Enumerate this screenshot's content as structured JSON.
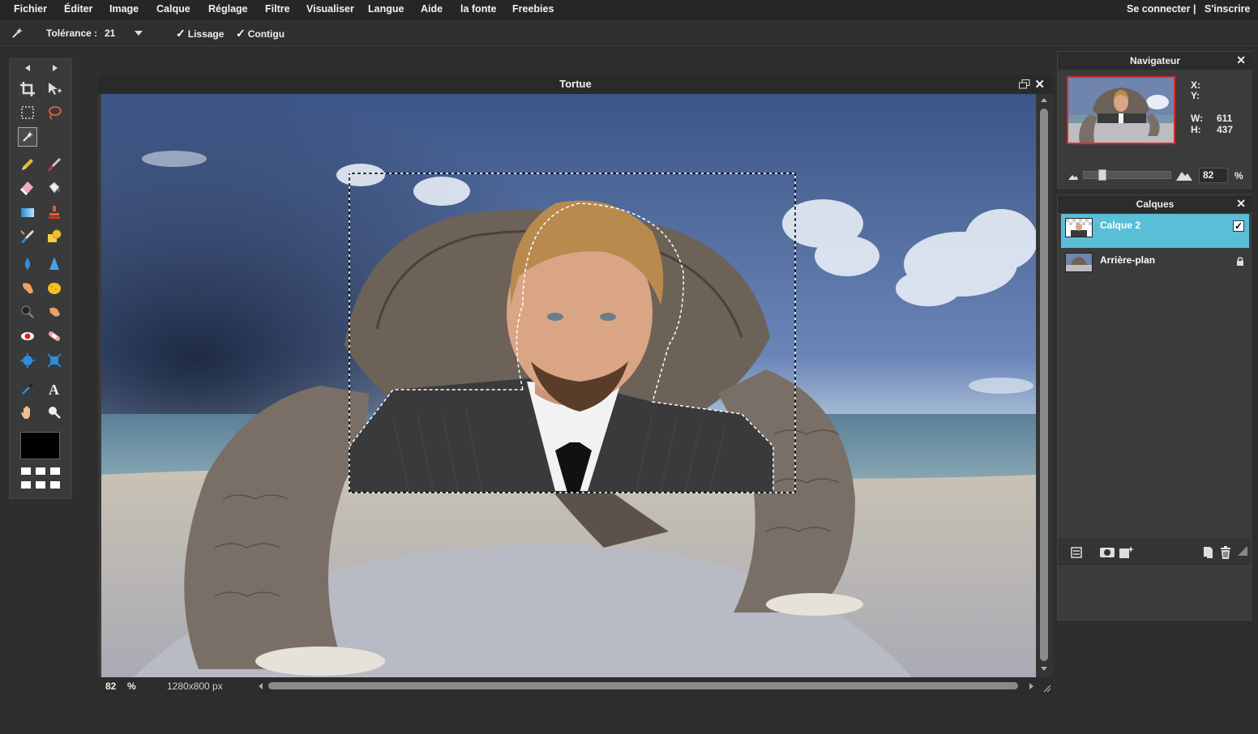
{
  "menubar": {
    "items": [
      "Fichier",
      "Éditer",
      "Image",
      "Calque",
      "Réglage",
      "Filtre",
      "Visualiser",
      "Langue",
      "Aide",
      "la fonte",
      "Freebies"
    ],
    "login": "Se connecter",
    "separator": "|",
    "signup": "S'inscrire"
  },
  "options": {
    "tool_icon": "magic-wand-icon",
    "tolerance_label": "Tolérance :",
    "tolerance_value": "21",
    "antialias_label": "Lissage",
    "antialias_checked": true,
    "contiguous_label": "Contigu",
    "contiguous_checked": true
  },
  "tools": {
    "items": [
      "crop",
      "move",
      "marquee",
      "lasso",
      "magic-wand",
      "pencil",
      "brush",
      "eraser",
      "paint-bucket",
      "gradient",
      "clone-stamp",
      "color-replace",
      "drawing",
      "blur",
      "sharpen",
      "smudge",
      "sponge",
      "dodge",
      "burn",
      "red-eye",
      "spot-heal",
      "bloat",
      "pinch",
      "color-picker",
      "type",
      "hand",
      "zoom"
    ],
    "active": "magic-wand",
    "foreground_color": "#000000"
  },
  "document": {
    "title": "Tortue",
    "zoom": "82",
    "zoom_unit": "%",
    "size": "1280x800 px"
  },
  "navigator": {
    "title": "Navigateur",
    "x_label": "X:",
    "y_label": "Y:",
    "x_value": "",
    "y_value": "",
    "w_label": "W:",
    "w_value": "611",
    "h_label": "H:",
    "h_value": "437",
    "zoom_value": "82",
    "zoom_unit": "%"
  },
  "layers": {
    "title": "Calques",
    "items": [
      {
        "name": "Calque 2",
        "selected": true,
        "visible": true
      },
      {
        "name": "Arrière-plan",
        "selected": false,
        "locked": true
      }
    ]
  },
  "colors": {
    "accent": "#58bfd7",
    "menubar_bg": "#262626",
    "panel_bg": "#3b3b3b",
    "navigator_frame": "#e02a2a"
  }
}
